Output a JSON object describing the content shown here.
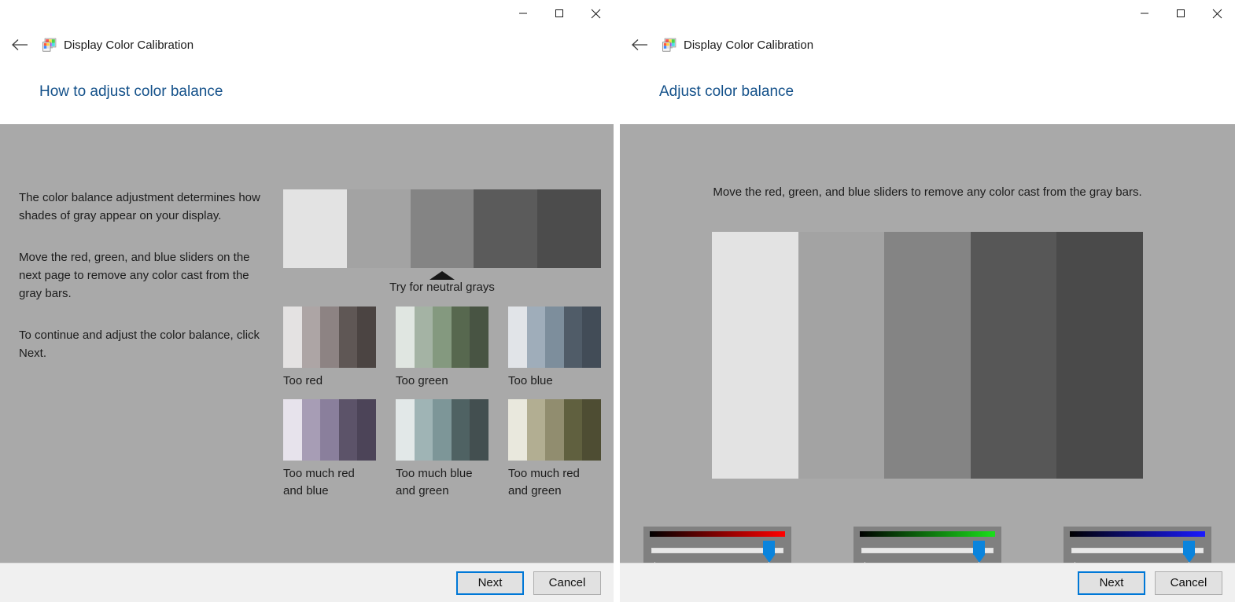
{
  "app": {
    "name": "Display Color Calibration",
    "icon": "display-calibration-icon"
  },
  "caption": {
    "minimize": "minimize-icon",
    "maximize": "maximize-icon",
    "close": "close-icon",
    "back": "back-arrow-icon"
  },
  "buttons": {
    "next": "Next",
    "cancel": "Cancel"
  },
  "left_window": {
    "title": "How to adjust color balance",
    "paragraphs": [
      "The color balance adjustment determines how shades of gray appear on your display.",
      "Move the red, green, and blue sliders on the next page to remove any color cast from the gray bars.",
      "To continue and adjust the color balance, click Next."
    ],
    "caret_label": "Try for neutral grays",
    "master_bars": [
      "#e3e3e3",
      "#a3a3a3",
      "#848484",
      "#5b5b5b",
      "#4c4c4c"
    ],
    "samples": [
      {
        "label": "Too red",
        "bars": [
          "#e4e2e2",
          "#ada5a5",
          "#8d8383",
          "#5f5755",
          "#4b4442"
        ]
      },
      {
        "label": "Too green",
        "bars": [
          "#e0e6e1",
          "#a4b3a4",
          "#84997f",
          "#57684f",
          "#485443"
        ]
      },
      {
        "label": "Too blue",
        "bars": [
          "#e1e4e8",
          "#9fadba",
          "#7d8e9c",
          "#505c68",
          "#424c57"
        ]
      },
      {
        "label": "Too much red and blue",
        "bars": [
          "#e7e3ec",
          "#a79db5",
          "#8a7f9c",
          "#5c5369",
          "#4c4458"
        ]
      },
      {
        "label": "Too much blue and green",
        "bars": [
          "#e2e8e8",
          "#9fb4b5",
          "#7d9698",
          "#4f6263",
          "#434f50"
        ]
      },
      {
        "label": "Too much red and green",
        "bars": [
          "#e9e8dd",
          "#b2ae92",
          "#918d6f",
          "#60603f",
          "#4e4d33"
        ]
      }
    ]
  },
  "right_window": {
    "title": "Adjust color balance",
    "instruction": "Move the red, green, and blue sliders to remove any color cast from the gray bars.",
    "gray_bars": [
      "#e3e3e3",
      "#a3a3a3",
      "#848484",
      "#575757",
      "#4a4a4a"
    ],
    "sliders": [
      {
        "name": "red",
        "color": "#ff0000",
        "value": 93
      },
      {
        "name": "green",
        "color": "#1ae01a",
        "value": 93
      },
      {
        "name": "blue",
        "color": "#1a1aff",
        "value": 93
      }
    ]
  }
}
